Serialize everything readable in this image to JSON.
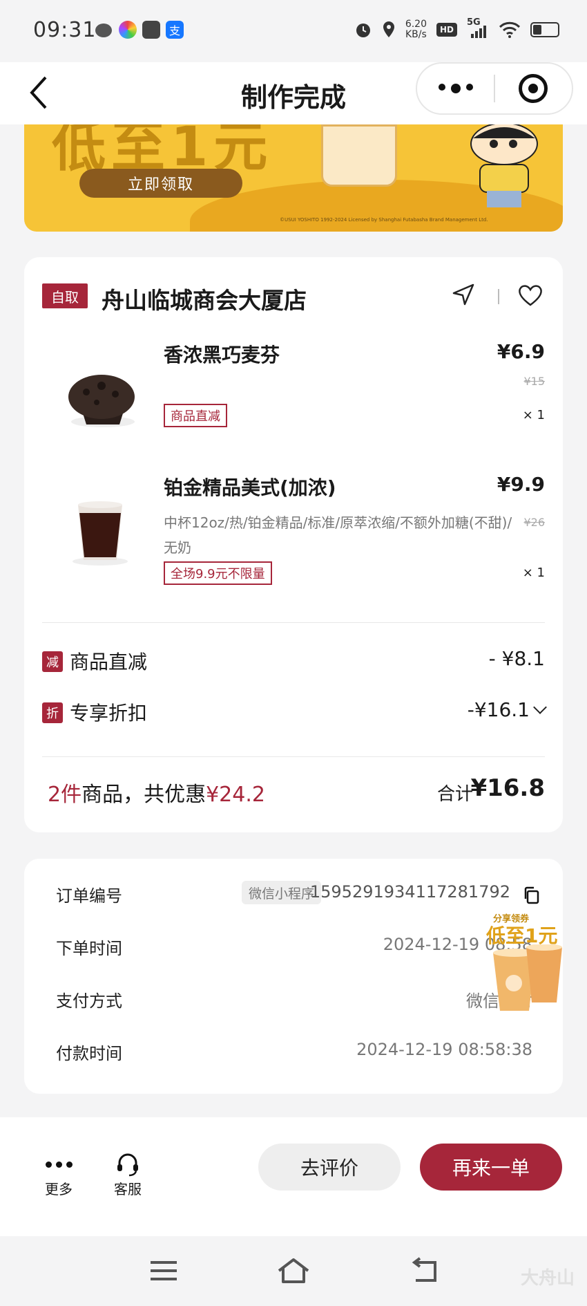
{
  "status_bar": {
    "time": "09:31",
    "net_speed_value": "6.20",
    "net_speed_unit": "KB/s",
    "hd_label": "HD",
    "signal_label": "5G"
  },
  "nav": {
    "title": "制作完成"
  },
  "banner": {
    "headline": "低至1元",
    "claim_button": "立即领取",
    "license_text": "©USUI YOSHITO 1992-2024 Licensed by Shanghai Futabasha Brand Management Ltd."
  },
  "store": {
    "pickup_tag": "自取",
    "name": "舟山临城商会大厦店"
  },
  "items": [
    {
      "name": "香浓黑巧麦芬",
      "price": "¥6.9",
      "original_price": "¥15",
      "spec": "",
      "tag": "商品直减",
      "qty": "× 1"
    },
    {
      "name": "铂金精品美式(加浓)",
      "price": "¥9.9",
      "original_price": "¥26",
      "spec": "中杯12oz/热/铂金精品/标准/原萃浓缩/不额外加糖(不甜)/无奶",
      "tag": "全场9.9元不限量",
      "qty": "× 1"
    }
  ],
  "discounts": [
    {
      "badge": "减",
      "label": "商品直减",
      "amount": "- ¥8.1"
    },
    {
      "badge": "折",
      "label": "专享折扣",
      "amount": "-¥16.1"
    }
  ],
  "summary": {
    "count_text": "2件",
    "middle_text": "商品，共优惠",
    "saved": "¥24.2",
    "total_label": "合计",
    "total": "¥16.8"
  },
  "order_info": {
    "order_no_label": "订单编号",
    "channel_tag": "微信小程序",
    "order_no": "1595291934117281792",
    "order_time_label": "下单时间",
    "order_time": "2024-12-19 08:58",
    "pay_method_label": "支付方式",
    "pay_method": "微信支付",
    "pay_time_label": "付款时间",
    "pay_time": "2024-12-19 08:58:38"
  },
  "float_ad": {
    "top": "分享领券",
    "main": "低至1元"
  },
  "bottom_bar": {
    "more_label": "更多",
    "service_label": "客服",
    "review_button": "去评价",
    "reorder_button": "再来一单"
  },
  "watermark": "大舟山",
  "colors": {
    "brand_red": "#a6263a",
    "banner_yellow": "#f6c437",
    "page_bg": "#f4f4f5"
  }
}
